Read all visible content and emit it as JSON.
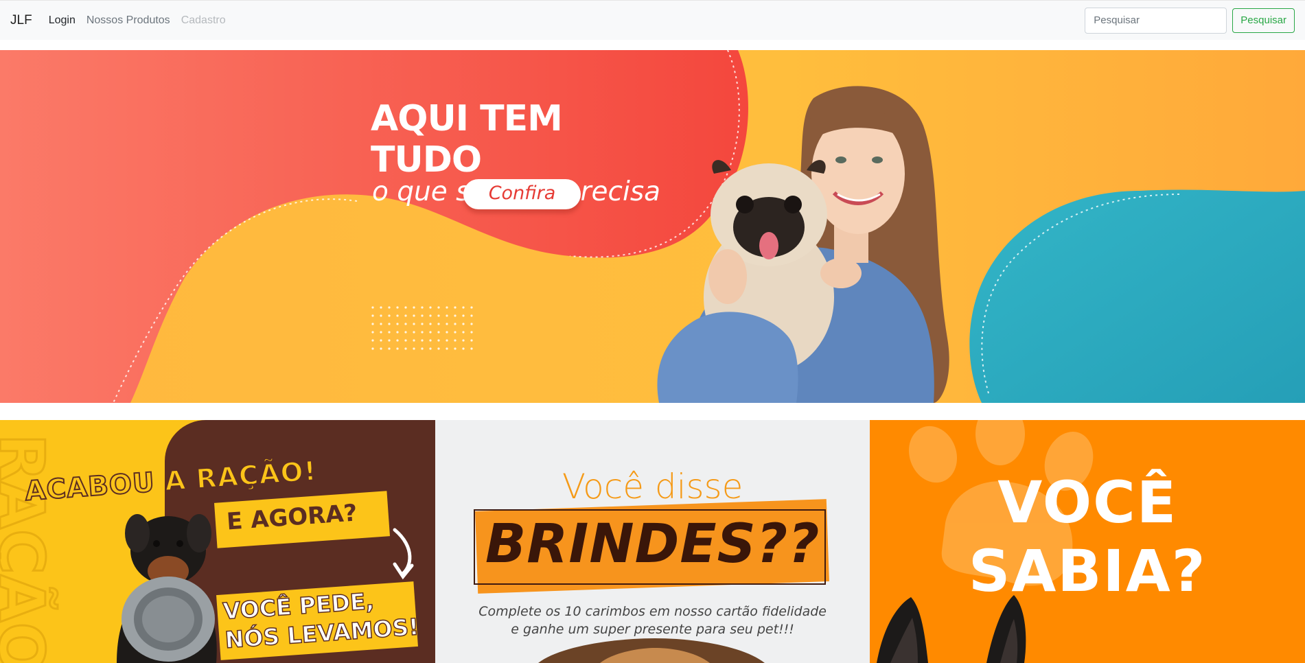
{
  "navbar": {
    "brand": "JLF",
    "links": [
      {
        "label": "Login",
        "state": "active"
      },
      {
        "label": "Nossos Produtos",
        "state": "normal"
      },
      {
        "label": "Cadastro",
        "state": "disabled"
      }
    ],
    "search": {
      "placeholder": "Pesquisar",
      "button_label": "Pesquisar"
    }
  },
  "hero": {
    "headline": "AQUI TEM TUDO",
    "subheadline": "o que seu Pet precisa",
    "cta_label": "Confira",
    "colors": {
      "coral": "#f5534a",
      "yellow": "#ffbb3c",
      "teal": "#2fb0c5"
    }
  },
  "cards": [
    {
      "headline": "ACABOU A RAÇÃO!",
      "subline": "E AGORA?",
      "tagline_1": "VOCÊ PEDE,",
      "tagline_2": "NÓS LEVAMOS!",
      "colors": {
        "yellow": "#fcc419",
        "brown": "#5b2d22"
      }
    },
    {
      "headline": "Você disse",
      "highlight": "BRINDES??",
      "body_line_1": "Complete os 10 carimbos em nosso cartão fidelidade",
      "body_line_2": "e ganhe um super presente para seu pet!!!",
      "colors": {
        "orange": "#f7941d",
        "dark": "#3a1609"
      }
    },
    {
      "headline_line_1": "VOCÊ",
      "headline_line_2": "SABIA?",
      "colors": {
        "orange": "#ff8a00"
      }
    }
  ]
}
